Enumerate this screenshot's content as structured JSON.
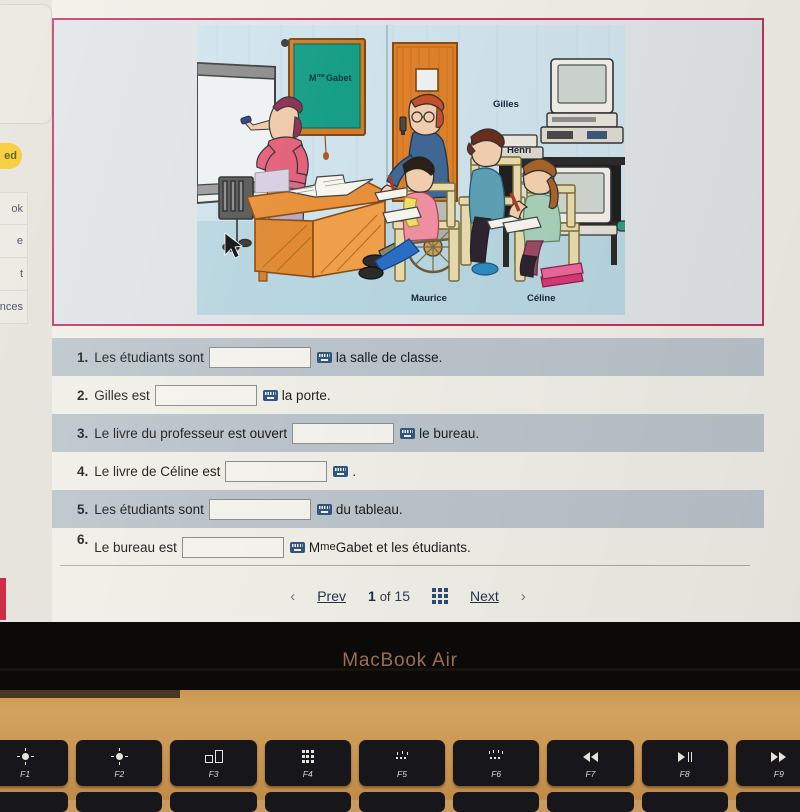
{
  "sidebar": {
    "badge": "ed",
    "items": [
      "ok",
      "e",
      "t",
      "nces"
    ]
  },
  "illustration": {
    "board_text": "M",
    "board_sup": "me",
    "board_name": " Gabet",
    "labels": {
      "gilles": "Gilles",
      "henri": "Henri",
      "maurice": "Maurice",
      "celine": "Céline"
    }
  },
  "questions": [
    {
      "num": "1.",
      "before": "Les étudiants sont",
      "after": "la salle de classe.",
      "blank_width": 100,
      "shaded": true,
      "raised": false
    },
    {
      "num": "2.",
      "before": "Gilles est",
      "after": "la porte.",
      "blank_width": 100,
      "shaded": false,
      "raised": false
    },
    {
      "num": "3.",
      "before": "Le livre du professeur est ouvert",
      "after": "le bureau.",
      "blank_width": 100,
      "shaded": true,
      "raised": false
    },
    {
      "num": "4.",
      "before": "Le livre de Céline est",
      "after": ".",
      "blank_width": 100,
      "shaded": false,
      "raised": false
    },
    {
      "num": "5.",
      "before": "Les étudiants sont",
      "after": "du tableau.",
      "blank_width": 100,
      "shaded": true,
      "raised": false
    },
    {
      "num": "6.",
      "before": "Le bureau est",
      "after": "M",
      "after_sup": "me",
      "after_tail": " Gabet et les étudiants.",
      "blank_width": 100,
      "shaded": false,
      "raised": true
    }
  ],
  "pager": {
    "prev": "Prev",
    "current": "1",
    "of": "of",
    "total": "15",
    "next": "Next",
    "grid_icon": "grid-icon",
    "chevron_left": "‹",
    "chevron_right": "›"
  },
  "laptop": {
    "brand": "MacBook Air",
    "keys": [
      {
        "f": "F2",
        "icon": "brightness-up-icon"
      },
      {
        "f": "F3",
        "icon": "mission-control-icon"
      },
      {
        "f": "F4",
        "icon": "launchpad-icon"
      },
      {
        "f": "F5",
        "icon": "keyboard-backlight-down-icon"
      },
      {
        "f": "F6",
        "icon": "keyboard-backlight-up-icon"
      },
      {
        "f": "F7",
        "icon": "rewind-icon"
      },
      {
        "f": "F8",
        "icon": "play-pause-icon"
      },
      {
        "f": "F9",
        "icon": "fast-forward-icon"
      }
    ]
  },
  "colors": {
    "frame_red": "#c2315a",
    "row_shaded": "#b9c3c9",
    "page_bg": "#efeee6",
    "accent_blue": "#2b4a7a",
    "badge_yellow": "#f5c518",
    "body_gold": "#c8964f"
  }
}
